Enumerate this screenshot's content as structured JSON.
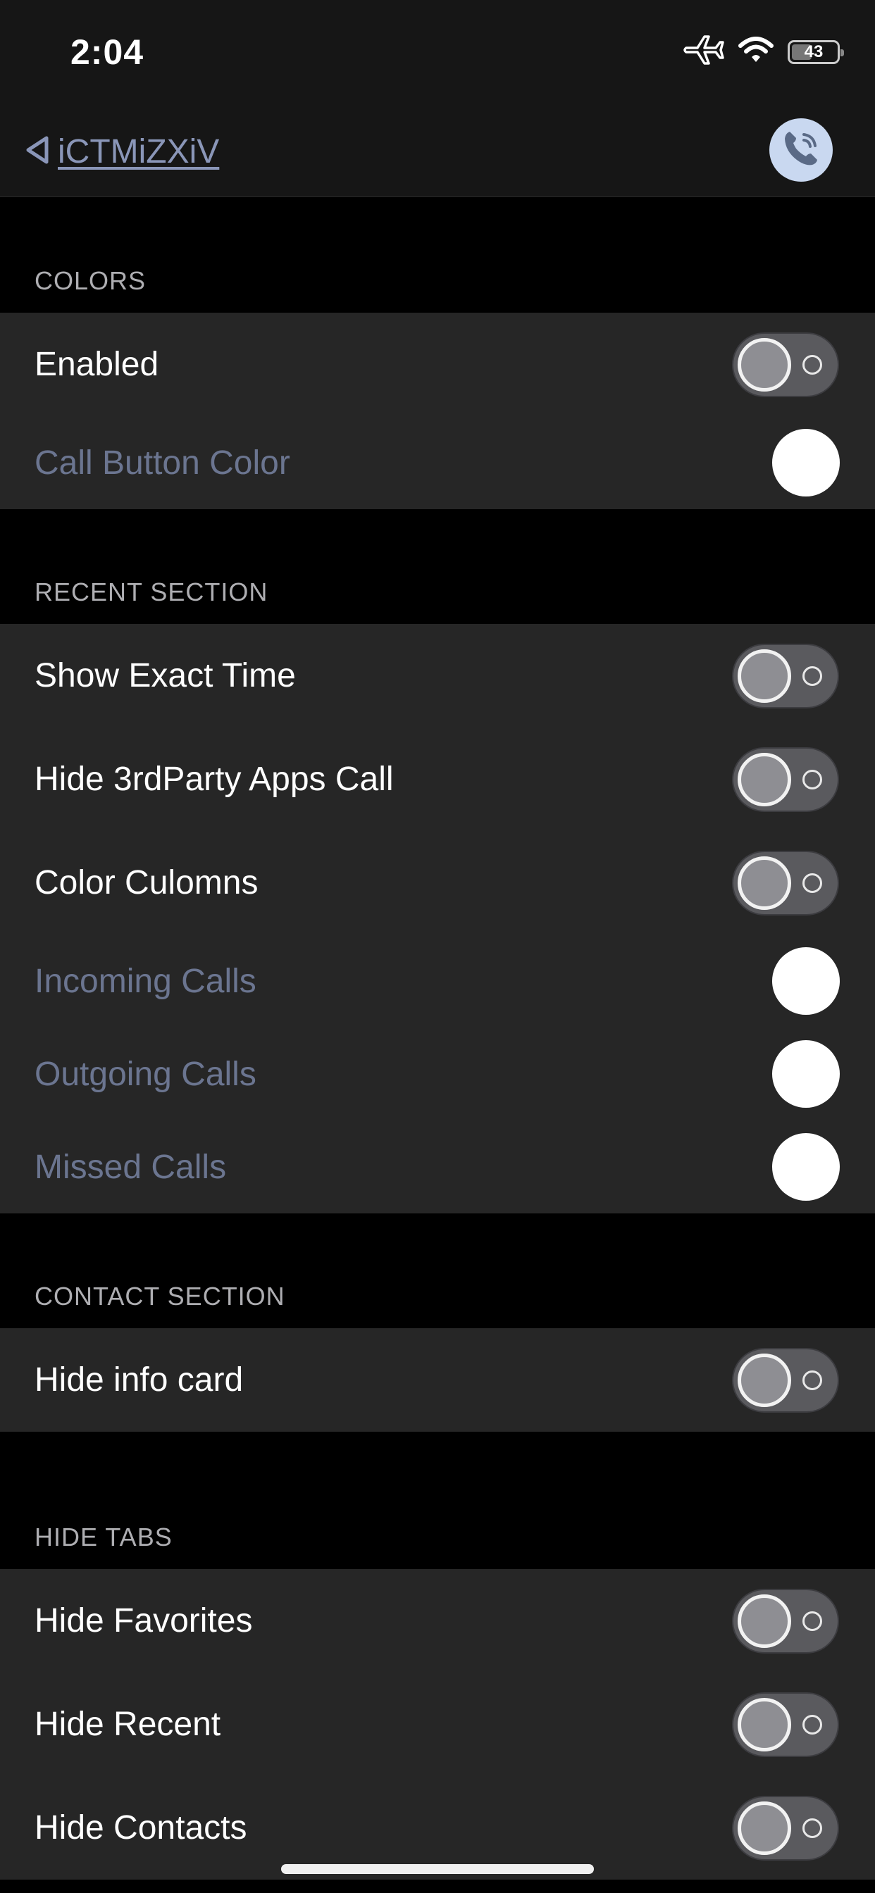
{
  "status_bar": {
    "time": "2:04",
    "battery": "43",
    "icons": [
      "airplane-icon",
      "wifi-icon",
      "battery-icon"
    ]
  },
  "nav": {
    "back_label": "iCTMiZXiV",
    "action_icon": "phone-icon",
    "action_color": "#c9d8f0"
  },
  "sections": {
    "colors": {
      "header": "COLORS",
      "enabled_label": "Enabled",
      "enabled_value": false,
      "call_button_color_label": "Call Button Color",
      "call_button_color": "#ffffff"
    },
    "recent": {
      "header": "RECENT SECTION",
      "show_exact_time_label": "Show Exact Time",
      "show_exact_time_value": false,
      "hide_3rdparty_label": "Hide 3rdParty Apps Call",
      "hide_3rdparty_value": false,
      "color_columns_label": "Color Culomns",
      "color_columns_value": false,
      "incoming_label": "Incoming Calls",
      "incoming_color": "#ffffff",
      "outgoing_label": "Outgoing Calls",
      "outgoing_color": "#ffffff",
      "missed_label": "Missed Calls",
      "missed_color": "#ffffff"
    },
    "contact": {
      "header": "CONTACT SECTION",
      "hide_info_card_label": "Hide info card",
      "hide_info_card_value": false
    },
    "hide_tabs": {
      "header": "HIDE TABS",
      "hide_favorites_label": "Hide Favorites",
      "hide_favorites_value": false,
      "hide_recent_label": "Hide Recent",
      "hide_recent_value": false,
      "hide_contacts_label": "Hide Contacts",
      "hide_contacts_value": false
    }
  },
  "colors": {
    "background": "#000000",
    "cell": "#262626",
    "label": "#ffffff",
    "dim_label": "#6b7590",
    "link": "#8a96b8"
  }
}
